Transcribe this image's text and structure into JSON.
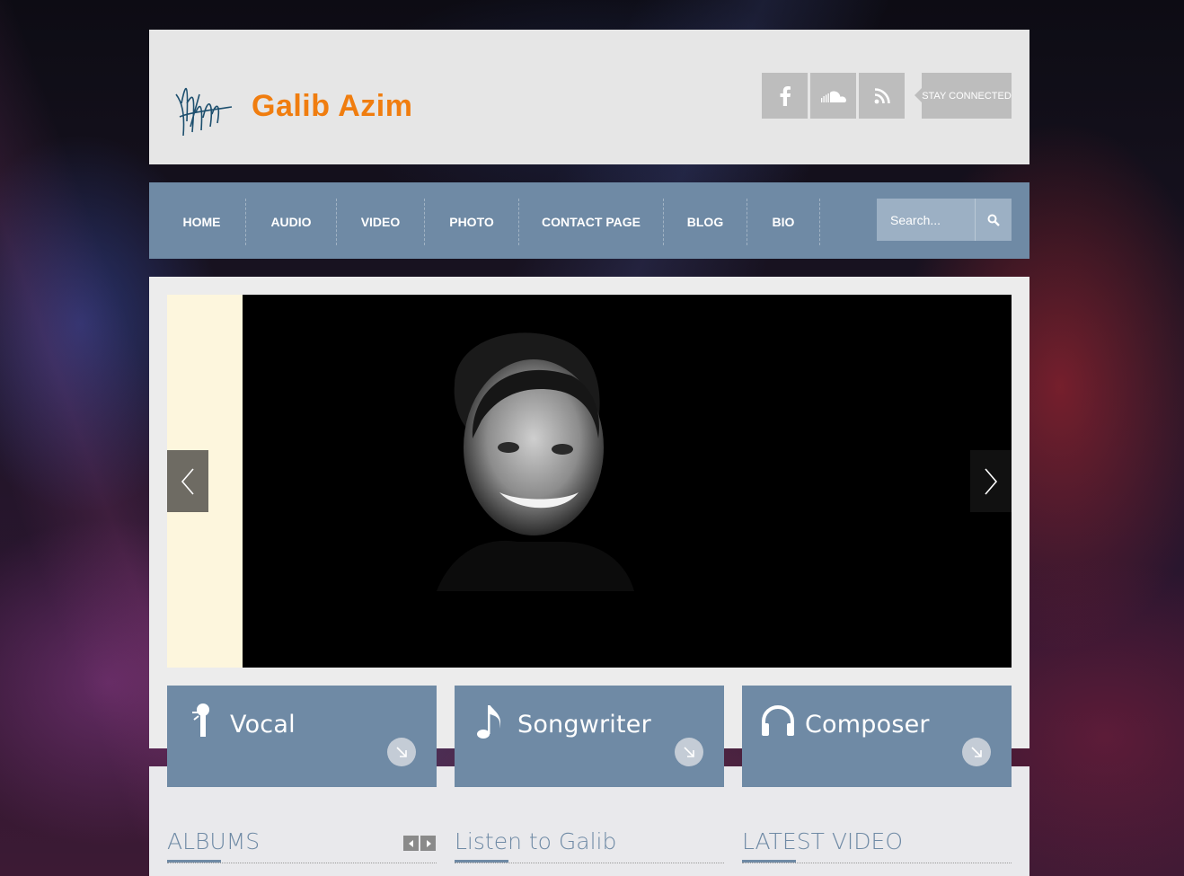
{
  "header": {
    "site_title": "Galib Azim",
    "stay_connected": "STAY CONNECTED",
    "social_icons": [
      "facebook-icon",
      "soundcloud-icon",
      "rss-icon"
    ]
  },
  "nav": {
    "items": [
      {
        "label": "HOME"
      },
      {
        "label": "AUDIO"
      },
      {
        "label": "VIDEO"
      },
      {
        "label": "PHOTO"
      },
      {
        "label": "CONTACT PAGE"
      },
      {
        "label": "BLOG"
      },
      {
        "label": "BIO"
      }
    ],
    "search_placeholder": "Search..."
  },
  "features": [
    {
      "label": "Vocal",
      "icon": "microphone-icon"
    },
    {
      "label": "Songwriter",
      "icon": "music-note-icon"
    },
    {
      "label": "Composer",
      "icon": "headphones-icon"
    }
  ],
  "sections": {
    "albums": "ALBUMS",
    "listen": "Listen to Galib",
    "latest_video": "LATEST VIDEO"
  },
  "colors": {
    "accent": "#6f8aa5",
    "title_orange": "#f07d0f",
    "header_bg": "#e6e6e6"
  }
}
